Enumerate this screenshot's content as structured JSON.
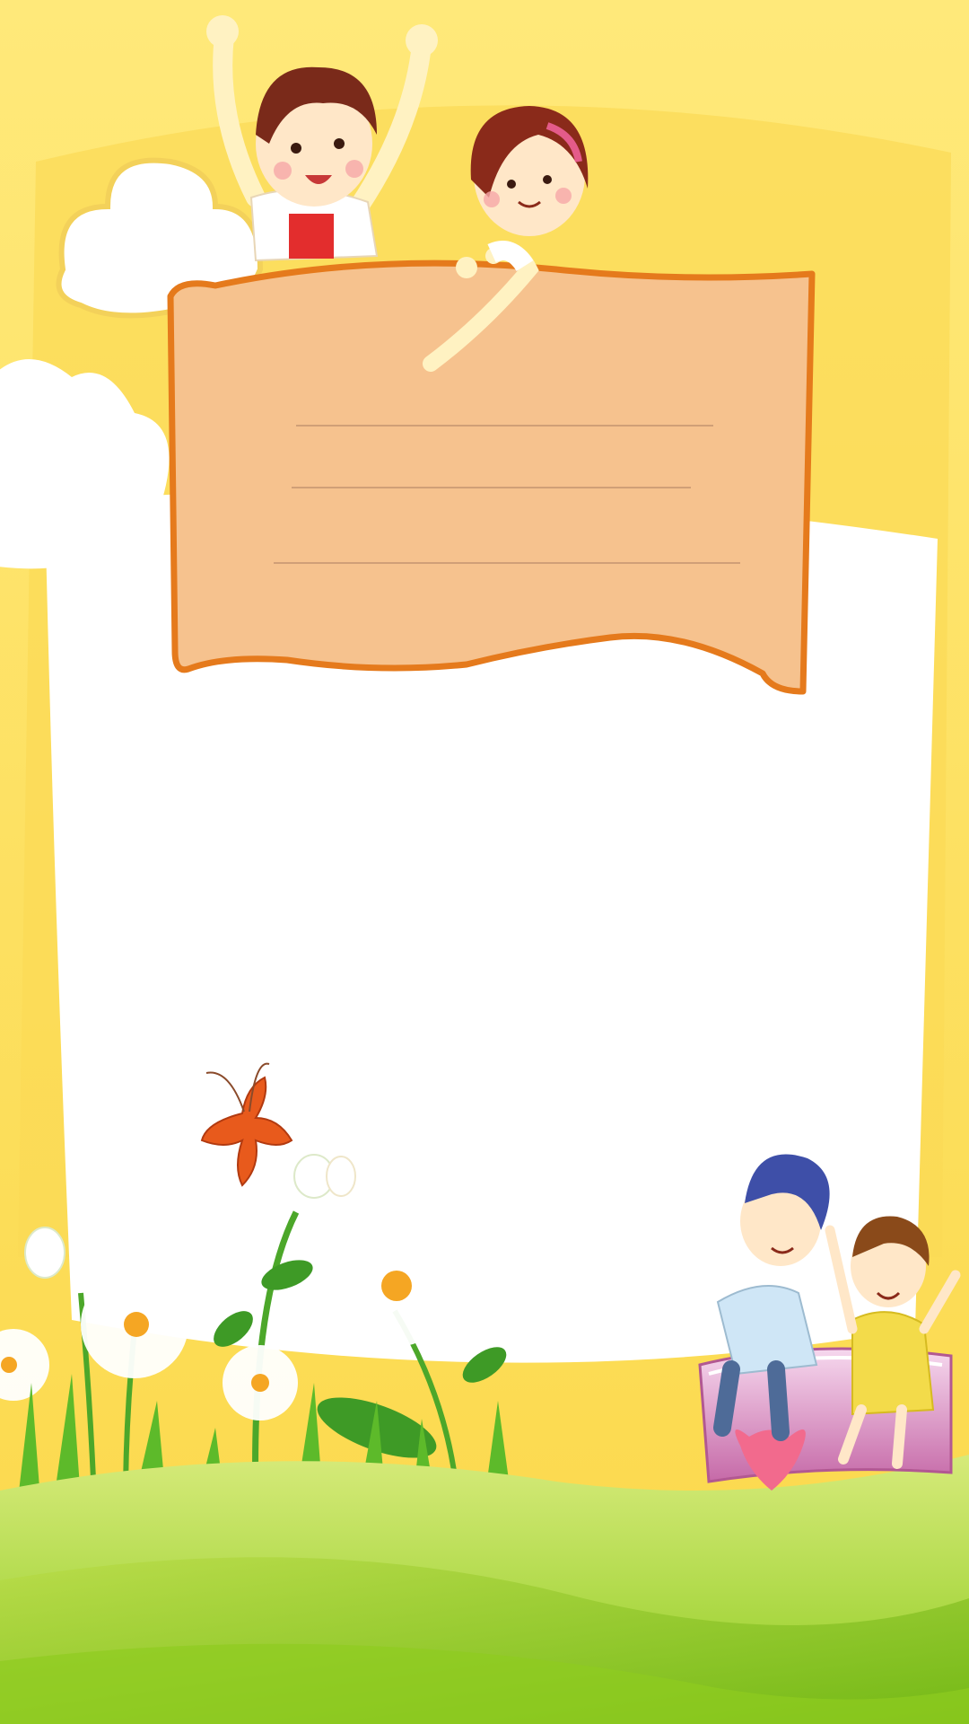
{
  "palette": {
    "background_yellow": "#FFE36E",
    "panel_yellow": "#FBD84A",
    "white_area": "#FFFFFF",
    "signboard_fill": "#F6C28E",
    "signboard_border": "#E57A1C",
    "writing_line": "#B98A6A",
    "grass_light": "#C8E26A",
    "grass_dark": "#7CC61E",
    "cloud": "#FFFFFF"
  },
  "signboard": {
    "writing_lines": 3,
    "text": ""
  },
  "decorations": [
    "boy-waving",
    "girl-pointing",
    "cloud",
    "butterfly",
    "daisy-flowers",
    "children-on-book",
    "heart",
    "green-hills"
  ]
}
